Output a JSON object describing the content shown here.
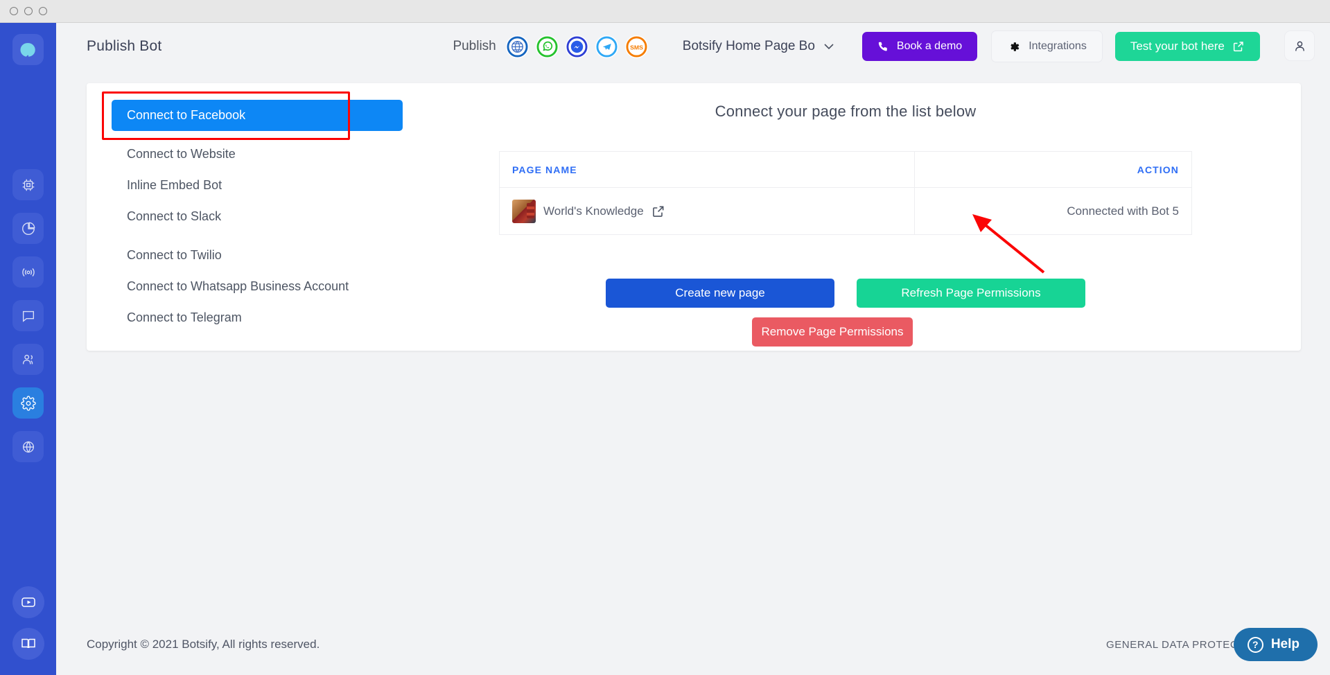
{
  "window": {
    "controls": [
      "close",
      "minimize",
      "maximize"
    ]
  },
  "brand": {
    "logo_icon": "chat-drop-logo"
  },
  "header": {
    "page_title": "Publish Bot",
    "publish_label": "Publish",
    "channels": [
      {
        "name": "web-channel-icon",
        "label": "",
        "color": "#1565c0"
      },
      {
        "name": "whatsapp-channel-icon",
        "label": "",
        "color": "#25c22e"
      },
      {
        "name": "messenger-channel-icon",
        "label": "",
        "color": "#2e3fd4"
      },
      {
        "name": "telegram-channel-icon",
        "label": "",
        "color": "#2fa8f5"
      },
      {
        "name": "sms-channel-icon",
        "label": "SMS",
        "color": "#f57c00"
      }
    ],
    "bot_selector": {
      "value": "Botsify Home Page Bo",
      "caret": "chevron-down-icon"
    },
    "book_demo_label": "Book a demo",
    "integrations_label": "Integrations",
    "test_bot_label": "Test your bot here",
    "profile_icon": "user-icon"
  },
  "sidebar": {
    "items": [
      {
        "icon": "cpu-chip-icon",
        "active": false
      },
      {
        "icon": "pie-chart-icon",
        "active": false
      },
      {
        "icon": "broadcast-icon",
        "active": false
      },
      {
        "icon": "chat-bubble-icon",
        "active": false
      },
      {
        "icon": "users-icon",
        "active": false
      },
      {
        "icon": "gear-icon",
        "active": true
      },
      {
        "icon": "globe-icon",
        "active": false
      }
    ],
    "bottom_items": [
      {
        "icon": "video-play-icon"
      },
      {
        "icon": "book-icon"
      }
    ]
  },
  "menu": {
    "items": [
      {
        "label": "Connect to Facebook",
        "active": true
      },
      {
        "label": "Connect to Website",
        "active": false
      },
      {
        "label": "Inline Embed Bot",
        "active": false
      },
      {
        "label": "Connect to Slack",
        "active": false
      },
      {
        "label": "Connect to Twilio",
        "active": false
      },
      {
        "label": "Connect to Whatsapp Business Account",
        "active": false
      },
      {
        "label": "Connect to Telegram",
        "active": false
      }
    ],
    "highlight_color": "#fb0505"
  },
  "panel": {
    "heading": "Connect your page from the list below",
    "table": {
      "columns": [
        "PAGE NAME",
        "ACTION"
      ],
      "rows": [
        {
          "page_name": "World's Knowledge",
          "external_link_icon": "external-link-icon",
          "action": "Connected with Bot 5"
        }
      ]
    },
    "buttons": {
      "create": "Create new page",
      "refresh": "Refresh Page Permissions",
      "remove": "Remove Page Permissions"
    }
  },
  "footer": {
    "copyright": "Copyright © 2021 Botsify, All rights reserved.",
    "gdpr": "GENERAL DATA PROTECTION REGU",
    "help_label": "Help",
    "help_icon": "question-circle-icon"
  },
  "colors": {
    "rail": "#3150ce",
    "accent_blue": "#0d87f5",
    "green": "#1ed697",
    "purple": "#6610d8",
    "red": "#ea5a62",
    "header_blue": "#2f6ef5"
  }
}
